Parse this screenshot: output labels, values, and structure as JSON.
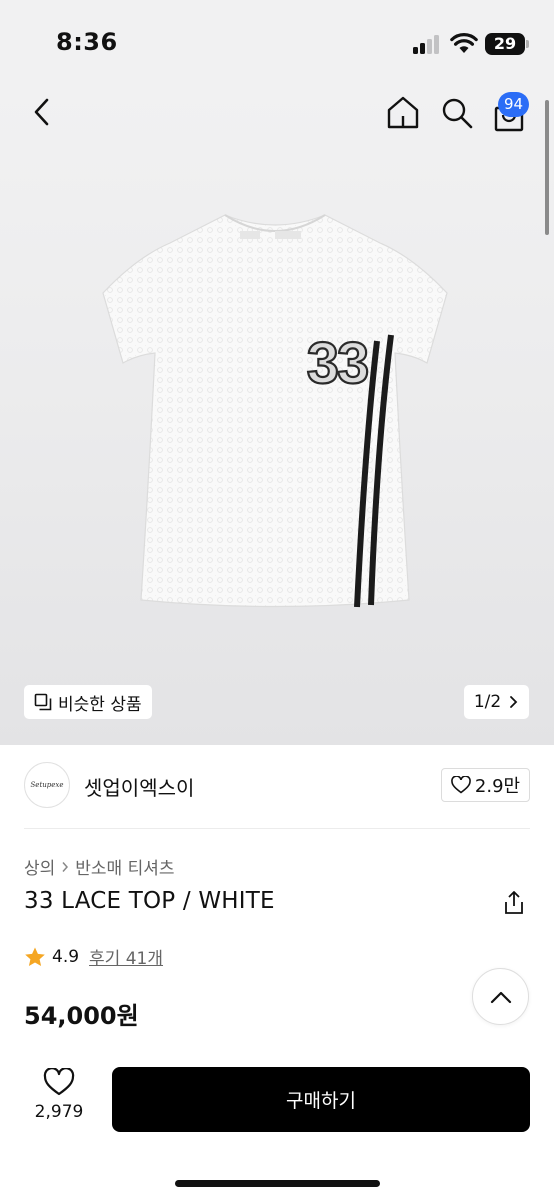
{
  "status_bar": {
    "time": "8:36",
    "battery": "29",
    "icons": [
      "cellular-signal-icon",
      "wifi-icon",
      "battery-icon"
    ]
  },
  "header": {
    "icons": [
      "back-icon",
      "home-icon",
      "search-icon",
      "cart-icon"
    ],
    "cart_badge": "94"
  },
  "gallery": {
    "image": "white-lace-t-shirt-with-33-print",
    "print_text": "33",
    "similar_label": "비슷한 상품",
    "page_indicator": "1/2"
  },
  "brand": {
    "logo_text": "Setupexe",
    "name": "셋업이엑스이",
    "likes": "2.9만"
  },
  "product": {
    "breadcrumb": [
      "상의",
      "반소매 티셔츠"
    ],
    "title": "33 LACE TOP / WHITE",
    "rating": "4.9",
    "reviews_label": "후기 41개",
    "price": "54,000원"
  },
  "bottom_bar": {
    "like_count": "2,979",
    "buy_label": "구매하기"
  },
  "colors": {
    "accent_badge": "#2b6df6",
    "star": "#f5a623",
    "buy_button": "#000000"
  }
}
